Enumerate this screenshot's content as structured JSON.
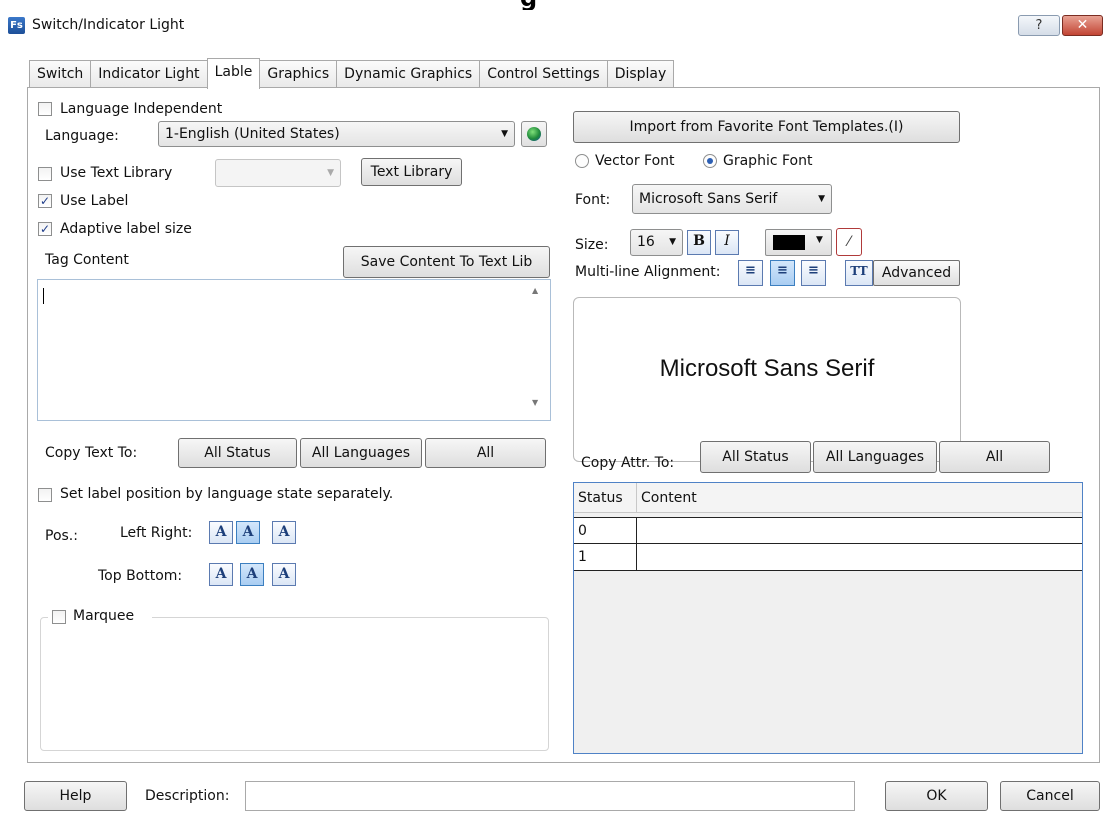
{
  "window": {
    "title": "Switch/Indicator Light",
    "icon_text": "Fs",
    "help_glyph": "?",
    "close_glyph": "✕",
    "background_fragment": "g"
  },
  "tabs": [
    {
      "label": "Switch"
    },
    {
      "label": "Indicator Light"
    },
    {
      "label": "Lable",
      "active": true
    },
    {
      "label": "Graphics"
    },
    {
      "label": "Dynamic Graphics"
    },
    {
      "label": "Control Settings"
    },
    {
      "label": "Display"
    }
  ],
  "left": {
    "language_independent": {
      "label": "Language Independent",
      "checked": false
    },
    "language_label": "Language:",
    "language_value": "1-English (United States)",
    "use_text_library": {
      "label": "Use Text Library",
      "checked": false
    },
    "text_library_button": "Text Library",
    "use_label": {
      "label": "Use Label",
      "checked": true
    },
    "adaptive_label_size": {
      "label": "Adaptive label size",
      "checked": true
    },
    "tag_content_label": "Tag Content",
    "save_content_button": "Save Content To Text Lib",
    "copy_text_to_label": "Copy Text To:",
    "copy_all_status": "All Status",
    "copy_all_languages": "All Languages",
    "copy_all": "All",
    "set_label_position": {
      "label": "Set label position by language  state separately.",
      "checked": false
    },
    "pos_label": "Pos.:",
    "left_right_label": "Left Right:",
    "top_bottom_label": "Top Bottom:",
    "marquee": {
      "label": "Marquee",
      "checked": false
    }
  },
  "right": {
    "import_button": "Import from Favorite Font Templates.(I)",
    "vector_font": "Vector Font",
    "graphic_font": "Graphic Font",
    "font_label": "Font:",
    "font_value": "Microsoft Sans Serif",
    "size_label": "Size:",
    "size_value": "16",
    "bold_glyph": "B",
    "italic_glyph": "I",
    "text_color": "#000000",
    "multiline_label": "Multi-line Alignment:",
    "advanced_button": "Advanced",
    "tt_glyph": "TT",
    "preview_text": "Microsoft Sans Serif",
    "copy_attr_label": "Copy Attr. To:",
    "copy_all_status": "All Status",
    "copy_all_languages": "All Languages",
    "copy_all": "All",
    "table": {
      "columns": [
        "Status",
        "Content"
      ],
      "rows": [
        {
          "status": "0",
          "content": ""
        },
        {
          "status": "1",
          "content": ""
        }
      ]
    }
  },
  "bottom": {
    "help_button": "Help",
    "description_label": "Description:",
    "description_value": "",
    "ok_button": "OK",
    "cancel_button": "Cancel"
  }
}
